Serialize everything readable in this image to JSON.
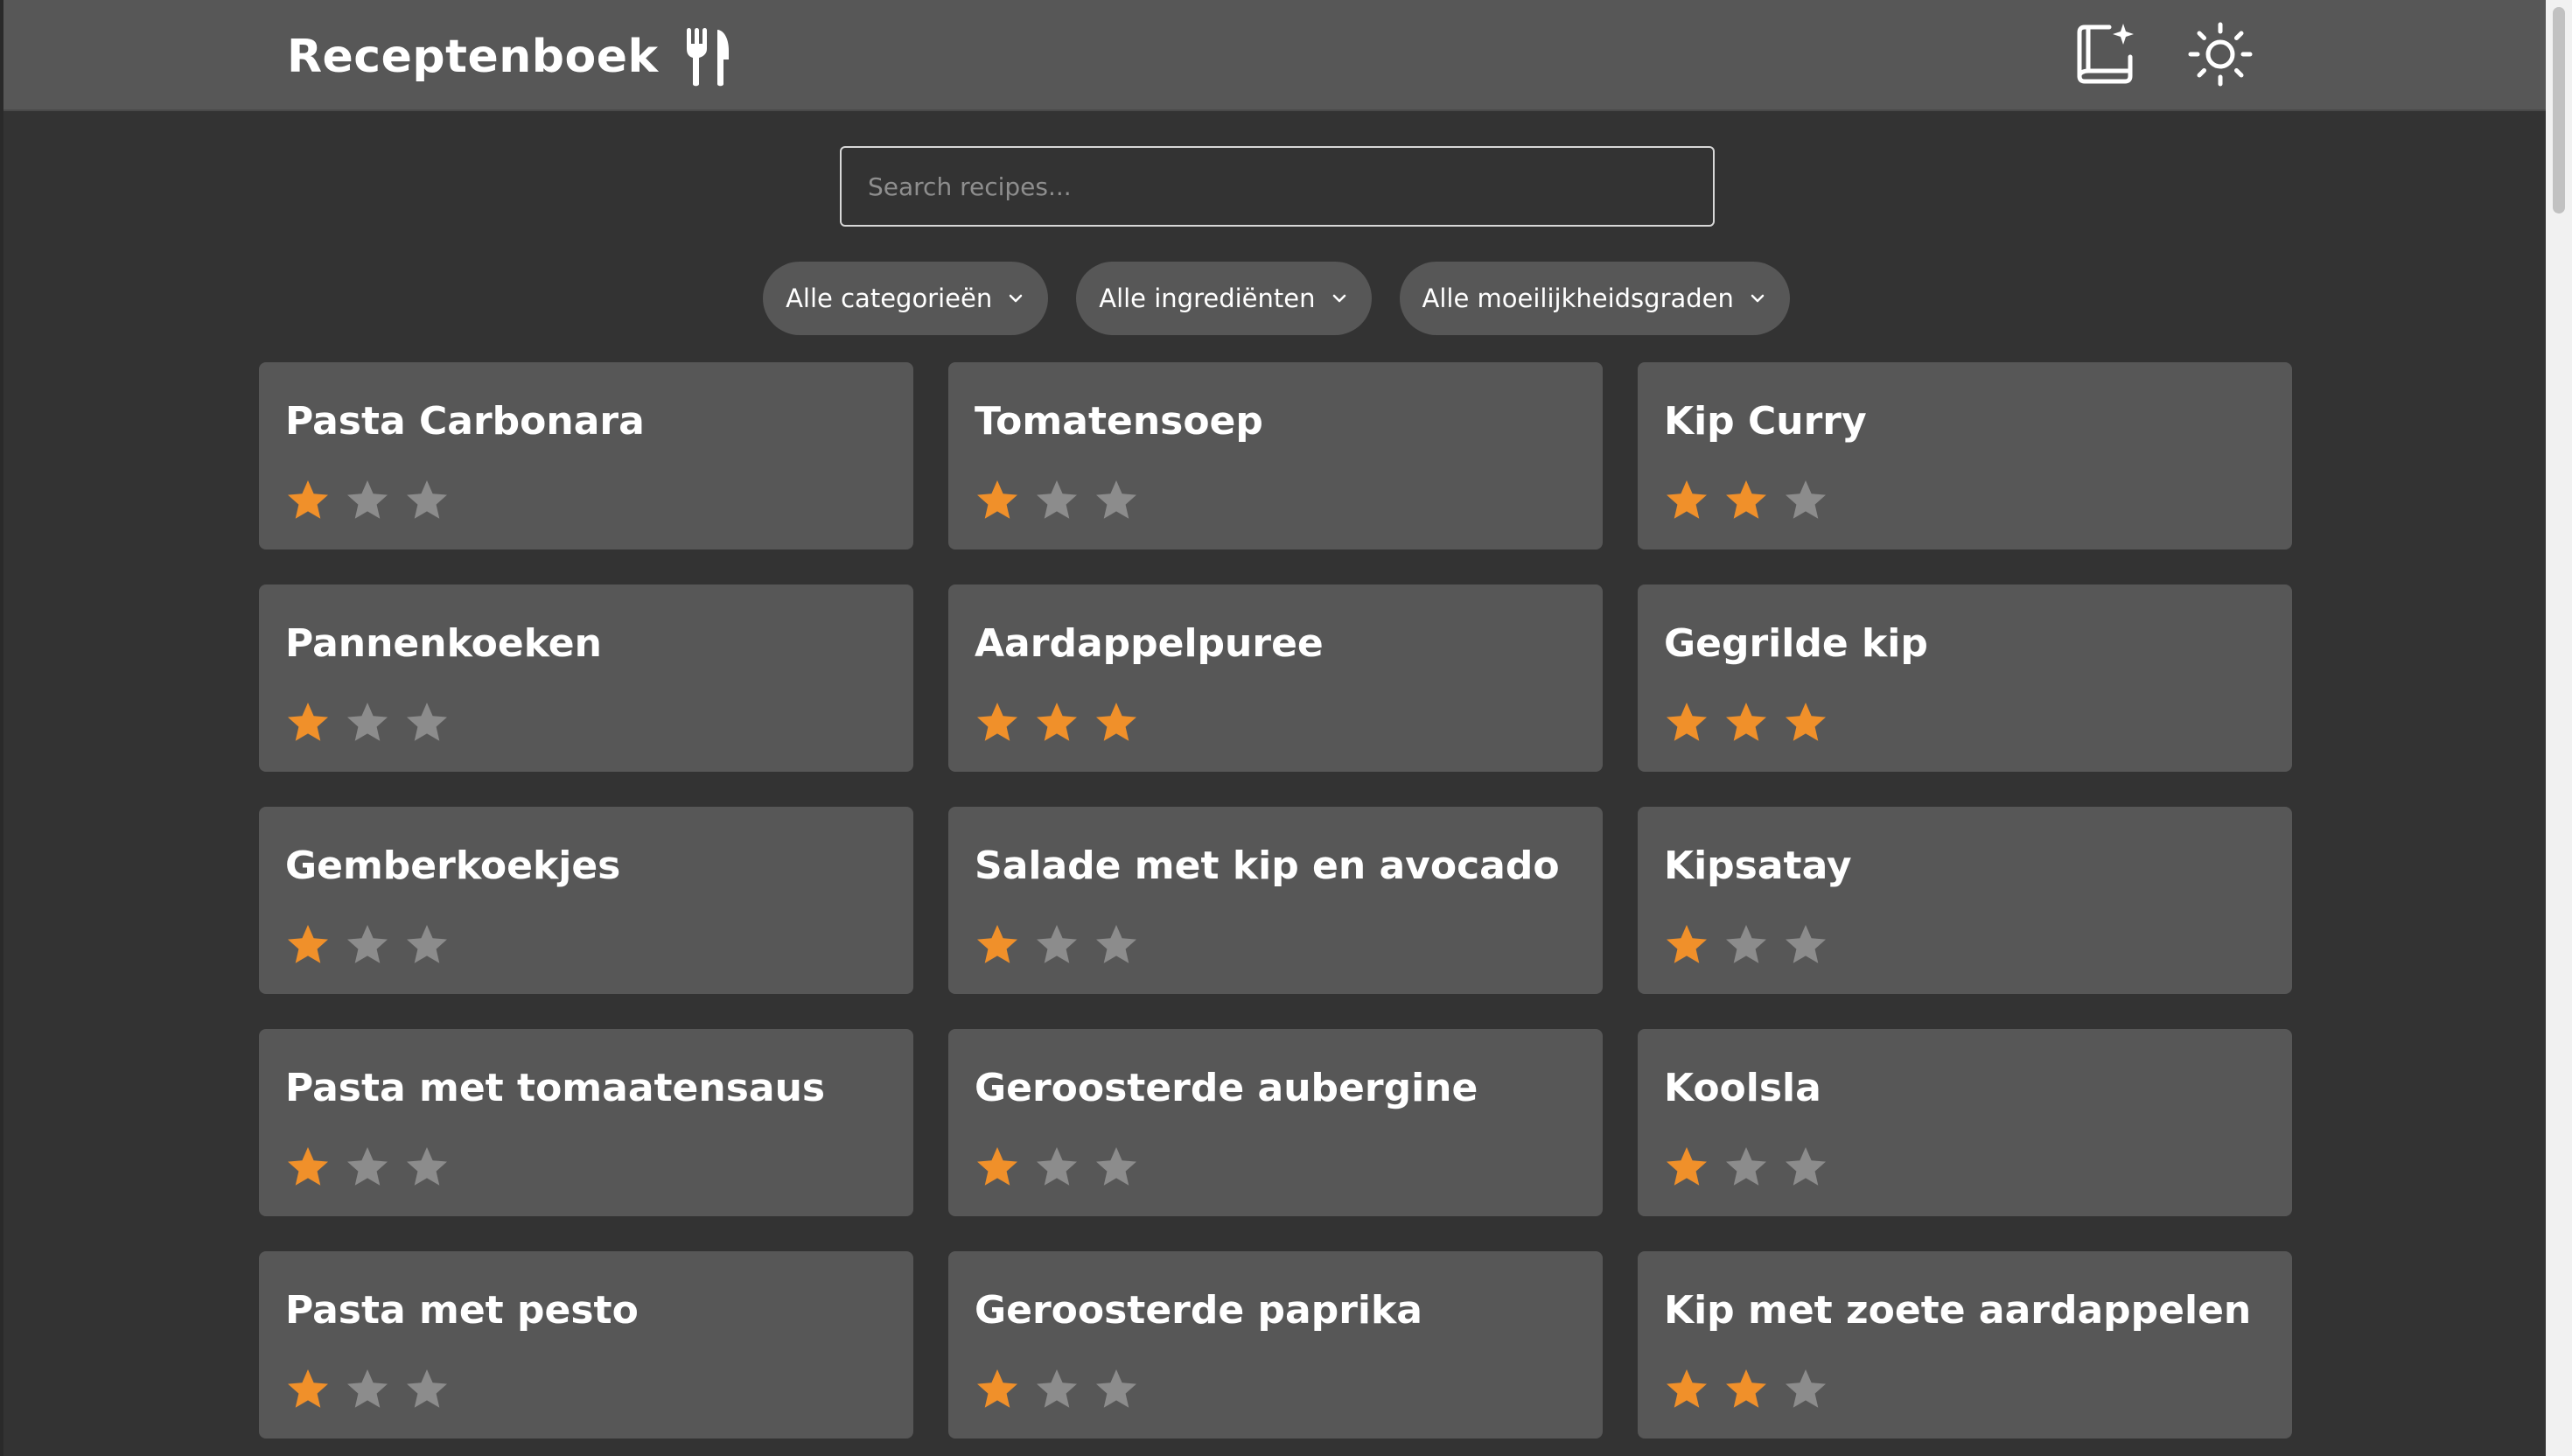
{
  "header": {
    "title": "Receptenboek",
    "icons": {
      "brand": "fork-knife-icon",
      "new_recipe": "new-recipe-icon",
      "theme": "sun-icon"
    }
  },
  "search": {
    "placeholder": "Search recipes..."
  },
  "filters": [
    {
      "label": "Alle categorieën"
    },
    {
      "label": "Alle ingrediënten"
    },
    {
      "label": "Alle moeilijkheidsgraden"
    }
  ],
  "colors": {
    "star_filled": "#f0902a",
    "star_empty": "#8c8c8c",
    "card": "#575757",
    "background": "#333333"
  },
  "recipes": [
    {
      "title": "Pasta Carbonara",
      "rating": 1,
      "max": 3
    },
    {
      "title": "Tomatensoep",
      "rating": 1,
      "max": 3
    },
    {
      "title": "Kip Curry",
      "rating": 2,
      "max": 3
    },
    {
      "title": "Pannenkoeken",
      "rating": 1,
      "max": 3
    },
    {
      "title": "Aardappelpuree",
      "rating": 3,
      "max": 3
    },
    {
      "title": "Gegrilde kip",
      "rating": 3,
      "max": 3
    },
    {
      "title": "Gemberkoekjes",
      "rating": 1,
      "max": 3
    },
    {
      "title": "Salade met kip en avocado",
      "rating": 1,
      "max": 3
    },
    {
      "title": "Kipsatay",
      "rating": 1,
      "max": 3
    },
    {
      "title": "Pasta met tomaatensaus",
      "rating": 1,
      "max": 3
    },
    {
      "title": "Geroosterde aubergine",
      "rating": 1,
      "max": 3
    },
    {
      "title": "Koolsla",
      "rating": 1,
      "max": 3
    },
    {
      "title": "Pasta met pesto",
      "rating": 1,
      "max": 3
    },
    {
      "title": "Geroosterde paprika",
      "rating": 1,
      "max": 3
    },
    {
      "title": "Kip met zoete aardappelen",
      "rating": 2,
      "max": 3
    }
  ]
}
